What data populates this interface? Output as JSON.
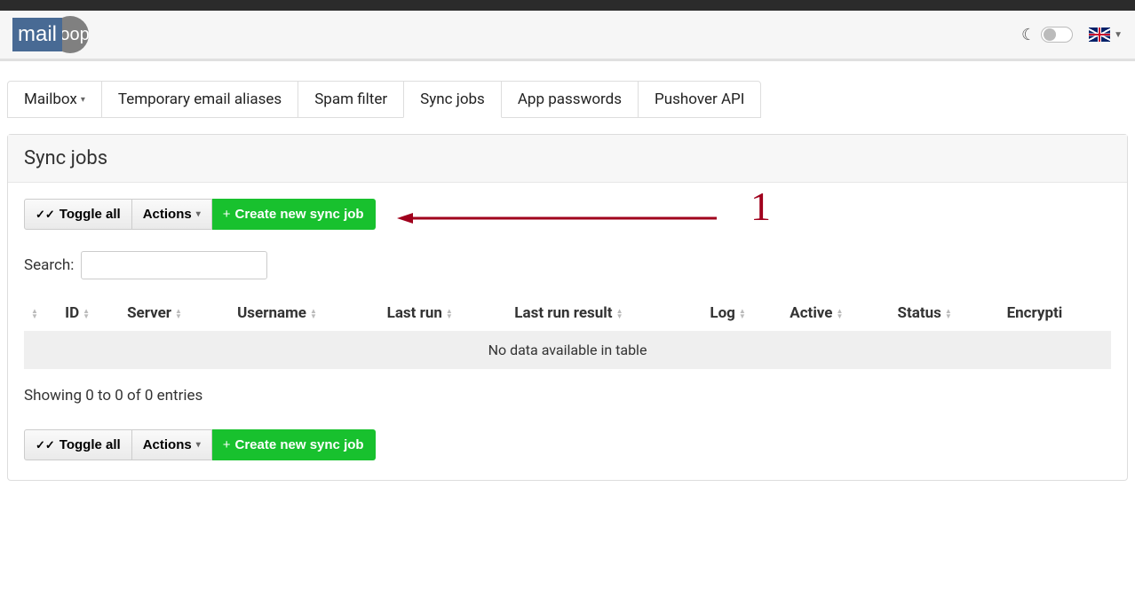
{
  "logo": {
    "left": "mail",
    "right": "coop"
  },
  "tabs": [
    {
      "label": "Mailbox",
      "dropdown": true
    },
    {
      "label": "Temporary email aliases"
    },
    {
      "label": "Spam filter"
    },
    {
      "label": "Sync jobs",
      "active": true
    },
    {
      "label": "App passwords"
    },
    {
      "label": "Pushover API"
    }
  ],
  "panel": {
    "title": "Sync jobs"
  },
  "toolbar": {
    "toggle_all": "Toggle all",
    "actions": "Actions",
    "create": "Create new sync job"
  },
  "search": {
    "label": "Search:"
  },
  "columns": [
    "",
    "ID",
    "Server",
    "Username",
    "Last run",
    "Last run result",
    "Log",
    "Active",
    "Status",
    "Encrypti"
  ],
  "table": {
    "empty": "No data available in table",
    "showing": "Showing 0 to 0 of 0 entries"
  },
  "annotation": {
    "number": "1"
  }
}
